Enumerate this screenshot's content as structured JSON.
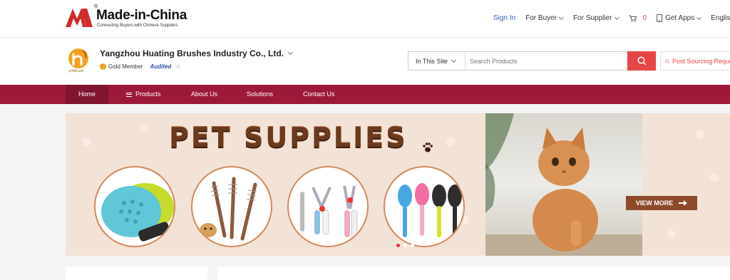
{
  "site": {
    "brand_name": "Made-in-China",
    "registered_mark": "®",
    "tagline": "Connecting Buyers with Chinese Suppliers"
  },
  "top_nav": {
    "sign_in": "Sign In",
    "for_buyer": "For Buyer",
    "for_supplier": "For Supplier",
    "cart_count": "0",
    "get_apps": "Get Apps",
    "language": "English"
  },
  "company": {
    "logo_text": "yzhtbrush",
    "name": "Yangzhou Huating Brushes Industry Co., Ltd.",
    "membership": "Gold Member",
    "audited": "Audited"
  },
  "search": {
    "scope": "In This Site",
    "placeholder": "Search Products",
    "post_sourcing": "Post Sourcing Request"
  },
  "nav": {
    "items": [
      "Home",
      "Products",
      "About Us",
      "Solutions",
      "Contact Us"
    ]
  },
  "banner": {
    "headline": "PET SUPPLIES",
    "cta": "VIEW MORE",
    "slides": 3,
    "active_slide": 1
  },
  "colors": {
    "brand_red": "#e54545",
    "nav_bg": "#9d1939",
    "nav_active": "#7f1530",
    "banner_bg": "#f3e2d6",
    "cta_bg": "#8d4a2a",
    "link_blue": "#2f5fbf"
  },
  "icons": [
    "made-in-china-logo",
    "chevron-down-icon",
    "cart-icon",
    "phone-icon",
    "search-icon",
    "post-sourcing-icon",
    "menu-icon",
    "gold-member-icon",
    "star-icon",
    "arrow-right-icon",
    "paw-icon"
  ]
}
